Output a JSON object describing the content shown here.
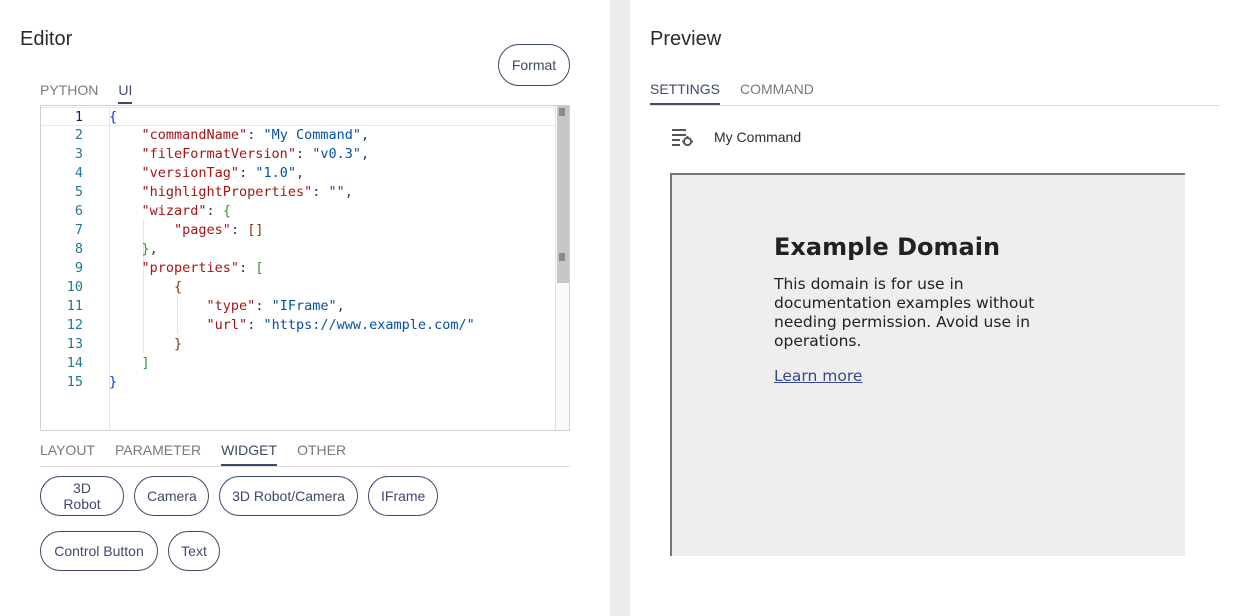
{
  "editor": {
    "title": "Editor",
    "format_label": "Format",
    "tabs": [
      {
        "label": "PYTHON",
        "active": false
      },
      {
        "label": "UI",
        "active": true
      }
    ],
    "code_lines": [
      {
        "num": "1",
        "text": "{"
      },
      {
        "num": "2",
        "text": "    \"commandName\": \"My Command\","
      },
      {
        "num": "3",
        "text": "    \"fileFormatVersion\": \"v0.3\","
      },
      {
        "num": "4",
        "text": "    \"versionTag\": \"1.0\","
      },
      {
        "num": "5",
        "text": "    \"highlightProperties\": \"\","
      },
      {
        "num": "6",
        "text": "    \"wizard\": {"
      },
      {
        "num": "7",
        "text": "        \"pages\": []"
      },
      {
        "num": "8",
        "text": "    },"
      },
      {
        "num": "9",
        "text": "    \"properties\": ["
      },
      {
        "num": "10",
        "text": "        {"
      },
      {
        "num": "11",
        "text": "            \"type\": \"IFrame\","
      },
      {
        "num": "12",
        "text": "            \"url\": \"https://www.example.com/\""
      },
      {
        "num": "13",
        "text": "        }"
      },
      {
        "num": "14",
        "text": "    ]"
      },
      {
        "num": "15",
        "text": "}"
      }
    ],
    "widget_tabs": [
      {
        "label": "LAYOUT",
        "active": false
      },
      {
        "label": "PARAMETER",
        "active": false
      },
      {
        "label": "WIDGET",
        "active": true
      },
      {
        "label": "OTHER",
        "active": false
      }
    ],
    "widgets": [
      "3D Robot",
      "Camera",
      "3D Robot/Camera",
      "IFrame",
      "Control Button",
      "Text"
    ]
  },
  "preview": {
    "title": "Preview",
    "tabs": [
      {
        "label": "SETTINGS",
        "active": true
      },
      {
        "label": "COMMAND",
        "active": false
      }
    ],
    "command_name": "My Command",
    "command_icon": "list-settings-icon",
    "iframe": {
      "heading": "Example Domain",
      "body": "This domain is for use in documentation examples without needing permission. Avoid use in operations.",
      "link": "Learn more"
    }
  },
  "colors": {
    "accent": "#3d4a6b",
    "json_key": "#a31515",
    "json_string": "#0451a5",
    "line_number": "#237893",
    "link": "#38488f"
  }
}
